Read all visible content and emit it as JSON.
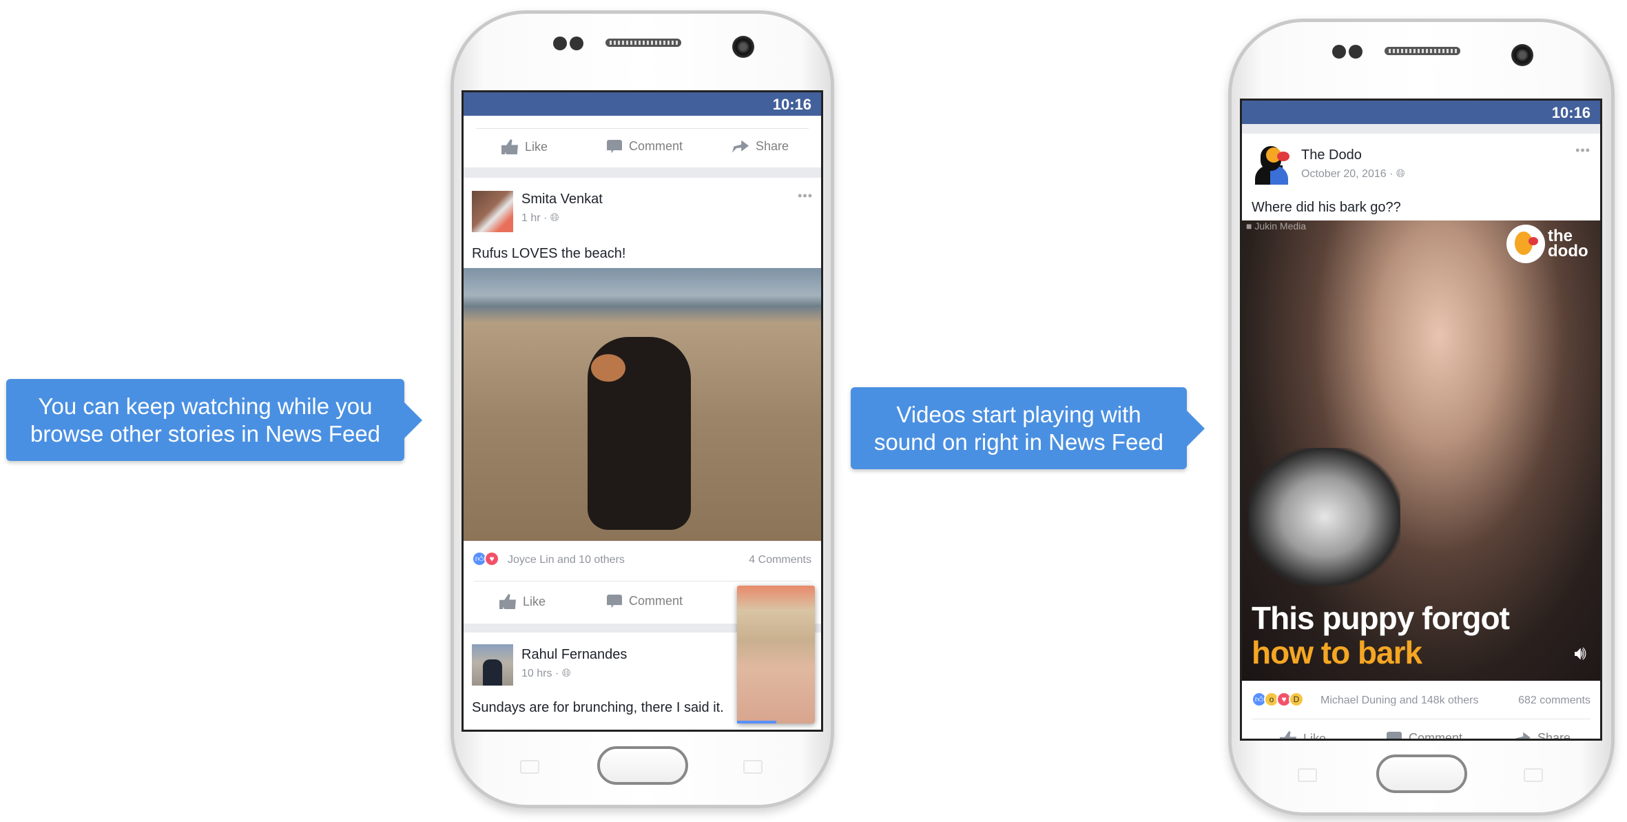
{
  "callouts": {
    "left": "You can keep watching while you browse other stories in News Feed",
    "middle": "Videos start playing with sound on right in News Feed"
  },
  "colors": {
    "facebook_blue": "#42609b",
    "callout_blue": "#4a90e2",
    "caption_orange": "#f5a623"
  },
  "left_phone": {
    "status_time": "10:16",
    "top_actions": {
      "like": "Like",
      "comment": "Comment",
      "share": "Share"
    },
    "post1": {
      "author": "Smita Venkat",
      "time": "1 hr",
      "text": "Rufus LOVES the beach!",
      "reactions_text": "Joyce Lin and 10 others",
      "comments": "4 Comments",
      "actions": {
        "like": "Like",
        "comment": "Comment"
      }
    },
    "post2": {
      "author": "Rahul Fernandes",
      "time": "10 hrs",
      "text": "Sundays are for brunching, there I said it."
    },
    "pip_video_progress": 0.5
  },
  "right_phone": {
    "status_time": "10:16",
    "post": {
      "author": "The Dodo",
      "date": "October 20, 2016",
      "text": "Where did his bark go??",
      "video_watermark": "Jukin Media",
      "logo_text": "the dodo",
      "caption_line1": "This puppy forgot",
      "caption_line2": "how to bark",
      "reactions_text": "Michael Duning and 148k others",
      "comments": "682 comments",
      "actions": {
        "like": "Like",
        "comment": "Comment",
        "share": "Share"
      }
    }
  }
}
